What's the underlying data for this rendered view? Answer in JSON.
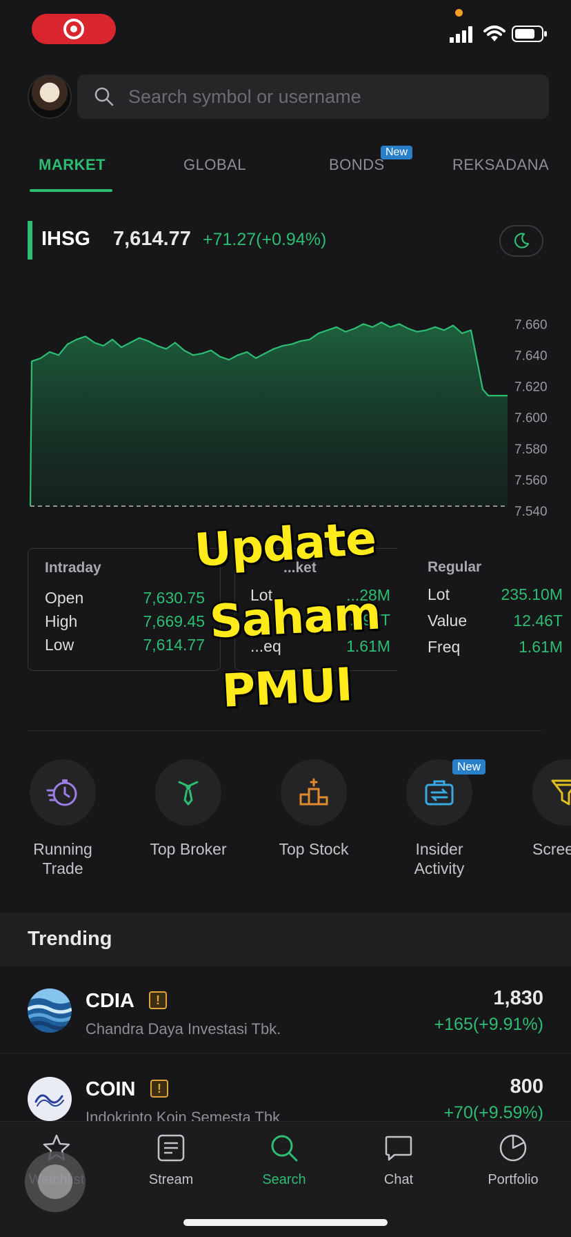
{
  "status_bar": {
    "recording_icon": "screen-record-icon",
    "signal_icon": "cellular-signal-icon",
    "wifi_icon": "wifi-icon",
    "battery_icon": "battery-icon"
  },
  "search": {
    "placeholder": "Search symbol or username"
  },
  "tabs": [
    {
      "label": "MARKET",
      "active": true
    },
    {
      "label": "GLOBAL"
    },
    {
      "label": "BONDS",
      "badge": "New"
    },
    {
      "label": "REKSADANA"
    }
  ],
  "index": {
    "name": "IHSG",
    "value": "7,614.77",
    "change": "+71.27(+0.94%)",
    "theme_icon": "moon-icon"
  },
  "chart_data": {
    "type": "area",
    "title": "",
    "xlabel": "",
    "ylabel": "",
    "ylim": [
      7540,
      7665
    ],
    "y_ticks": [
      "7.660",
      "7.640",
      "7.620",
      "7.600",
      "7.580",
      "7.560",
      "7.540"
    ],
    "reference_line": 7543,
    "color": "#2dbd72",
    "series": [
      {
        "values": [
          7543,
          7636,
          7638,
          7642,
          7640,
          7647,
          7650,
          7652,
          7648,
          7646,
          7650,
          7645,
          7648,
          7651,
          7649,
          7646,
          7644,
          7648,
          7643,
          7640,
          7641,
          7643,
          7639,
          7637,
          7640,
          7642,
          7638,
          7641,
          7644,
          7646,
          7647,
          7649,
          7650,
          7654,
          7656,
          7658,
          7655,
          7657,
          7660,
          7658,
          7661,
          7658,
          7660,
          7657,
          7655,
          7656,
          7658,
          7656,
          7659,
          7654,
          7656,
          7618,
          7614,
          7614
        ]
      }
    ]
  },
  "stats": {
    "intraday": {
      "title": "Intraday",
      "rows": [
        {
          "label": "Open",
          "value": "7,630.75"
        },
        {
          "label": "High",
          "value": "7,669.45"
        },
        {
          "label": "Low",
          "value": "7,614.77"
        }
      ]
    },
    "market": {
      "title": "...ket",
      "rows": [
        {
          "label": "Lot",
          "value": "...28M"
        },
        {
          "label": "...",
          "value": "...97T"
        },
        {
          "label": "...eq",
          "value": "1.61M"
        }
      ]
    },
    "regular": {
      "title": "Regular",
      "rows": [
        {
          "label": "Lot",
          "value": "235.10M"
        },
        {
          "label": "Value",
          "value": "12.46T"
        },
        {
          "label": "Freq",
          "value": "1.61M"
        }
      ]
    }
  },
  "quick_menu": [
    {
      "label": "Running Trade",
      "icon": "running-trade-icon",
      "color": "#9b7fe6"
    },
    {
      "label": "Top Broker",
      "icon": "top-broker-icon",
      "color": "#2dbd72"
    },
    {
      "label": "Top Stock",
      "icon": "top-stock-icon",
      "color": "#e08a30"
    },
    {
      "label": "Insider Activity",
      "icon": "insider-activity-icon",
      "color": "#3aa8e0",
      "badge": "New"
    },
    {
      "label": "Scree",
      "icon": "screener-icon",
      "color": "#e0c020"
    }
  ],
  "trending": {
    "title": "Trending",
    "items": [
      {
        "code": "CDIA",
        "name": "Chandra Daya Investasi Tbk.",
        "price": "1,830",
        "change": "+165(+9.91%)",
        "warning": "!"
      },
      {
        "code": "COIN",
        "name": "Indokripto Koin Semesta Tbk",
        "price": "800",
        "change": "+70(+9.59%)",
        "warning": "!"
      }
    ]
  },
  "bottom_nav": [
    {
      "label": "Watchlist",
      "icon": "star-icon"
    },
    {
      "label": "Stream",
      "icon": "stream-icon"
    },
    {
      "label": "Search",
      "icon": "search-icon",
      "active": true
    },
    {
      "label": "Chat",
      "icon": "chat-icon"
    },
    {
      "label": "Portfolio",
      "icon": "portfolio-icon"
    }
  ],
  "overlay": {
    "line1": "Update",
    "line2": "Saham",
    "line3": "PMUI"
  }
}
